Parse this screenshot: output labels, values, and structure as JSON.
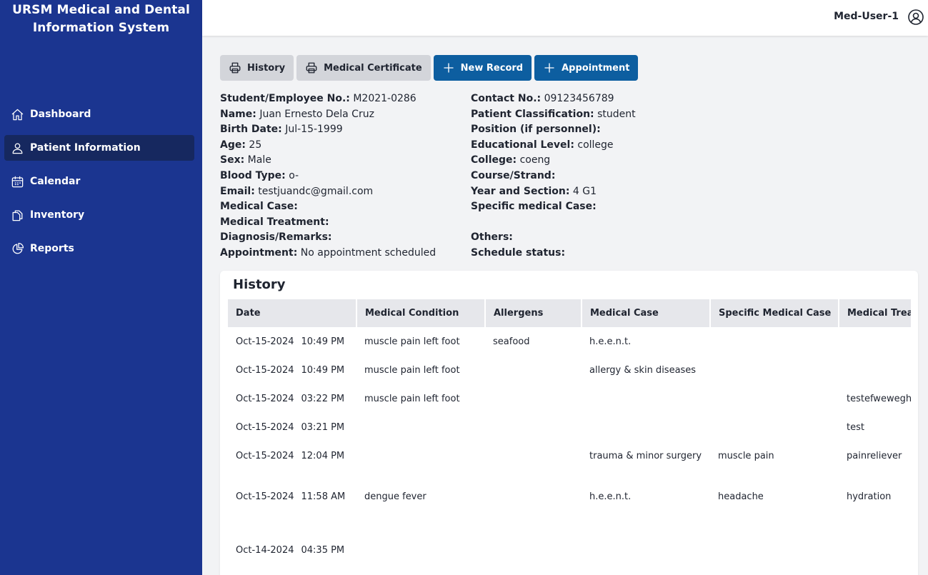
{
  "app": {
    "title": "URSM Medical and Dental Information System"
  },
  "sidebar": {
    "items": [
      {
        "label": "Dashboard",
        "icon": "home-icon"
      },
      {
        "label": "Patient Information",
        "icon": "user-icon",
        "active": true
      },
      {
        "label": "Calendar",
        "icon": "calendar-icon"
      },
      {
        "label": "Inventory",
        "icon": "copy-icon"
      },
      {
        "label": "Reports",
        "icon": "pie-chart-icon"
      }
    ]
  },
  "topbar": {
    "username": "Med-User-1"
  },
  "toolbar": {
    "history_label": "History",
    "certificate_label": "Medical Certificate",
    "new_record_label": "New Record",
    "appointment_label": "Appointment"
  },
  "patient": {
    "left": [
      {
        "key": "Student/Employee No.:",
        "value": "M2021-0286"
      },
      {
        "key": "Name:",
        "value": "Juan Ernesto Dela Cruz"
      },
      {
        "key": "Birth Date:",
        "value": "Jul-15-1999"
      },
      {
        "key": "Age:",
        "value": "25"
      },
      {
        "key": "Sex:",
        "value": "Male"
      },
      {
        "key": "Blood Type:",
        "value": "o-"
      },
      {
        "key": "Email:",
        "value": "testjuandc@gmail.com"
      },
      {
        "key": "Medical Case:",
        "value": ""
      },
      {
        "key": "Medical Treatment:",
        "value": ""
      },
      {
        "key": "Diagnosis/Remarks:",
        "value": ""
      },
      {
        "key": "Appointment:",
        "value": "No appointment scheduled"
      }
    ],
    "right": [
      {
        "key": "Contact No.:",
        "value": "09123456789"
      },
      {
        "key": "Patient Classification:",
        "value": "student"
      },
      {
        "key": "Position (if personnel):",
        "value": ""
      },
      {
        "key": "Educational Level:",
        "value": "college"
      },
      {
        "key": "College:",
        "value": "coeng"
      },
      {
        "key": "Course/Strand:",
        "value": ""
      },
      {
        "key": "Year and Section:",
        "value": "4 G1"
      },
      {
        "key": "Specific medical Case:",
        "value": ""
      },
      {
        "key": "",
        "value": ""
      },
      {
        "key": "Others:",
        "value": ""
      },
      {
        "key": "Schedule status:",
        "value": ""
      }
    ]
  },
  "history": {
    "title": "History",
    "columns": [
      "Date",
      "Medical Condition",
      "Allergens",
      "Medical Case",
      "Specific Medical Case",
      "Medical Treatment"
    ],
    "rows": [
      {
        "date": "Oct-15-2024",
        "time": "10:49 PM",
        "condition": "muscle pain left foot",
        "allergens": "seafood",
        "case": "h.e.e.n.t.",
        "specific": "",
        "treatment": ""
      },
      {
        "date": "Oct-15-2024",
        "time": "10:49 PM",
        "condition": "muscle pain left foot",
        "allergens": "",
        "case": "allergy & skin diseases",
        "specific": "",
        "treatment": ""
      },
      {
        "date": "Oct-15-2024",
        "time": "03:22 PM",
        "condition": "muscle pain left foot",
        "allergens": "",
        "case": "",
        "specific": "",
        "treatment": "testefwewegh"
      },
      {
        "date": "Oct-15-2024",
        "time": "03:21 PM",
        "condition": "",
        "allergens": "",
        "case": "",
        "specific": "",
        "treatment": "test"
      },
      {
        "date": "Oct-15-2024",
        "time": "12:04 PM",
        "condition": "",
        "allergens": "",
        "case": "trauma & minor surgery",
        "specific": "muscle pain",
        "treatment": "painreliever"
      },
      {
        "date": "Oct-15-2024",
        "time": "11:58 AM",
        "condition": "dengue fever",
        "allergens": "",
        "case": "h.e.e.n.t.",
        "specific": "headache",
        "treatment": "hydration"
      },
      {
        "date": "Oct-14-2024",
        "time": "04:35 PM",
        "condition": "",
        "allergens": "",
        "case": "",
        "specific": "",
        "treatment": ""
      }
    ]
  },
  "colors": {
    "sidebar_bg": "#1b3590",
    "sidebar_active": "#16285f",
    "primary_button": "#0d5ea0",
    "secondary_button": "#d3d5da"
  }
}
